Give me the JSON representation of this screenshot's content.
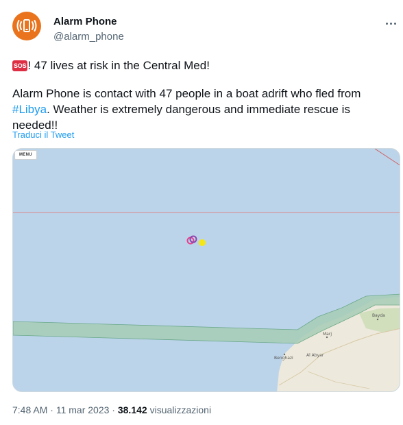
{
  "author": {
    "name": "Alarm Phone",
    "handle": "@alarm_phone",
    "avatar_icon": "phone-alarm-icon",
    "avatar_color": "#e9741d"
  },
  "tweet": {
    "sos_badge": "SOS",
    "line1": "! 47 lives at risk in the Central Med!",
    "para2_before": "Alarm Phone is contact with 47 people in a boat adrift who fled from ",
    "hashtag": "#Libya",
    "para2_after": ". Weather is extremely dangerous and immediate rescue is needed!!",
    "translate_link": "Traduci il Tweet",
    "link_color": "#1d9bf0"
  },
  "map": {
    "menu_label": "MENU",
    "places": {
      "bayda": "Bayda",
      "marj": "Marj",
      "benghazi": "Benghazi",
      "al_abyar": "Al Abyar"
    },
    "colors": {
      "sea": "#bcd4ea",
      "land": "#ede9dc",
      "zone": "#a8cdb7",
      "boundary": "#d98a8a",
      "marker_ring_pink": "#e83e8c",
      "marker_ring_purple": "#8e44ad",
      "marker_dot": "#f5e617"
    }
  },
  "meta": {
    "time": "7:48 AM",
    "separator": "·",
    "date": "11 mar 2023",
    "views_count": "38.142",
    "views_label": "visualizzazioni"
  }
}
